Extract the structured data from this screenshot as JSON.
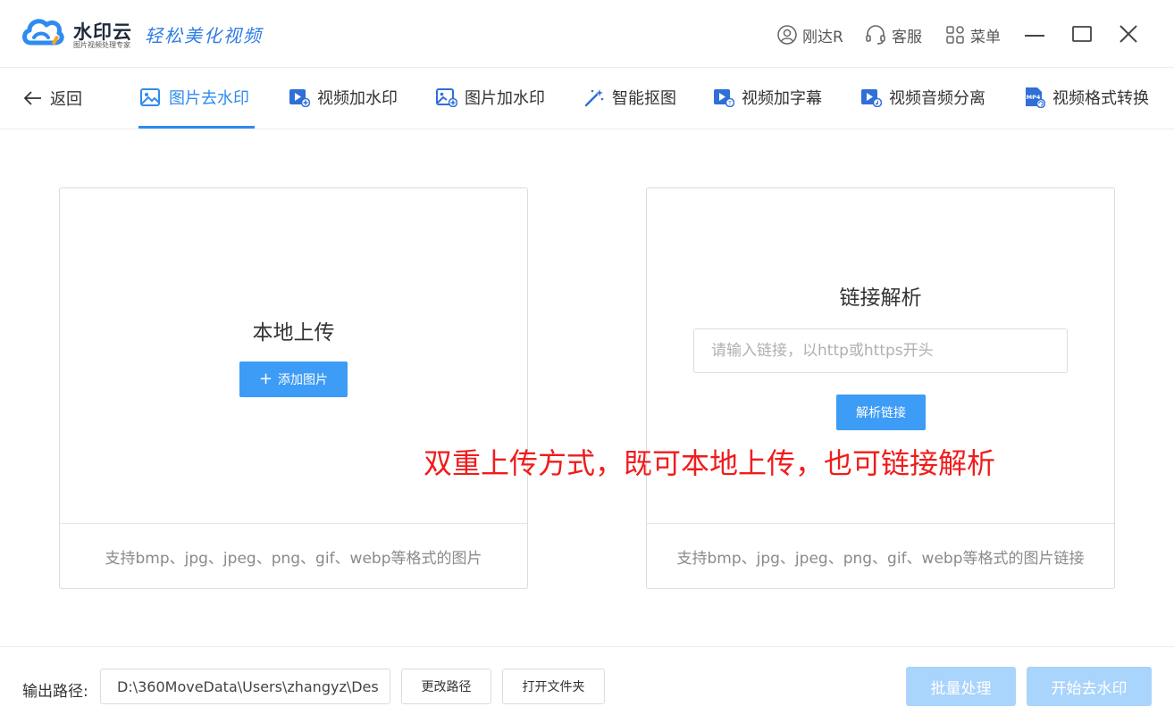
{
  "brand": {
    "name": "水印云",
    "subtitle": "图片视频处理专家",
    "slogan": "轻松美化视频",
    "accent_color": "#2f8bef"
  },
  "titlebar": {
    "user_label": "刚达R",
    "service_label": "客服",
    "menu_label": "菜单"
  },
  "nav": {
    "back_label": "返回",
    "tabs": [
      {
        "label": "图片去水印",
        "icon": "image-icon",
        "active": true
      },
      {
        "label": "视频加水印",
        "icon": "video-add-icon",
        "active": false
      },
      {
        "label": "图片加水印",
        "icon": "image-add-icon",
        "active": false
      },
      {
        "label": "智能抠图",
        "icon": "magic-wand-icon",
        "active": false
      },
      {
        "label": "视频加字幕",
        "icon": "video-subtitle-icon",
        "active": false
      },
      {
        "label": "视频音频分离",
        "icon": "video-audio-icon",
        "active": false
      },
      {
        "label": "视频格式转换",
        "icon": "mp4-file-icon",
        "active": false
      }
    ]
  },
  "local_upload": {
    "title": "本地上传",
    "button_label": "添加图片",
    "footer": "支持bmp、jpg、jpeg、png、gif、webp等格式的图片"
  },
  "link_parse": {
    "title": "链接解析",
    "placeholder": "请输入链接，以http或https开头",
    "button_label": "解析链接",
    "footer": "支持bmp、jpg、jpeg、png、gif、webp等格式的图片链接"
  },
  "overlay_caption": "双重上传方式，既可本地上传，也可链接解析",
  "bottom": {
    "output_label": "输出路径:",
    "output_path": "D:\\360MoveData\\Users\\zhangyz\\Des",
    "change_path_label": "更改路径",
    "open_folder_label": "打开文件夹",
    "batch_label": "批量处理",
    "start_label": "开始去水印"
  }
}
